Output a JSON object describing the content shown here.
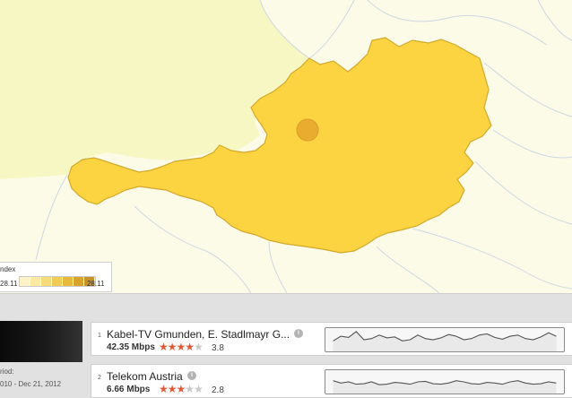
{
  "legend": {
    "title": "ndex",
    "min_label": "28.11",
    "max_label": "28.11",
    "colors": [
      "#fdf3c6",
      "#fbe9a4",
      "#f7db7a",
      "#f1cb55",
      "#e8b83c",
      "#d9a32b",
      "#c8922a"
    ]
  },
  "map": {
    "country_fill": "#fcd442",
    "country_stroke": "#d3a82c",
    "north_fill": "#f7f7c4",
    "background": "#fbfbe7",
    "border_color": "#cfd8e3",
    "marker_color": "#e9a82d",
    "marker": "city-marker"
  },
  "sidebar": {
    "period_label": "riod:",
    "period_value": "010 - Dec 21, 2012"
  },
  "providers": [
    {
      "rank": "1",
      "name": "Kabel-TV Gmunden, E. Stadlmayr G...",
      "speed": "42.35 Mbps",
      "stars_full": 4,
      "stars_total": 5,
      "rating": "3.8",
      "trend": [
        0.55,
        0.35,
        0.4,
        0.15,
        0.5,
        0.45,
        0.3,
        0.42,
        0.38,
        0.55,
        0.5,
        0.3,
        0.45,
        0.5,
        0.42,
        0.28,
        0.35,
        0.5,
        0.45,
        0.3,
        0.25,
        0.4,
        0.48,
        0.35,
        0.3,
        0.45,
        0.5,
        0.38,
        0.2,
        0.35
      ]
    },
    {
      "rank": "2",
      "name": "Telekom Austria",
      "speed": "6.66 Mbps",
      "stars_full": 3,
      "stars_total": 5,
      "rating": "2.8",
      "trend": [
        0.45,
        0.55,
        0.5,
        0.6,
        0.58,
        0.5,
        0.62,
        0.6,
        0.52,
        0.55,
        0.6,
        0.5,
        0.48,
        0.58,
        0.6,
        0.55,
        0.45,
        0.5,
        0.58,
        0.6,
        0.52,
        0.55,
        0.6,
        0.5,
        0.45,
        0.55,
        0.6,
        0.58,
        0.5,
        0.55
      ]
    }
  ]
}
